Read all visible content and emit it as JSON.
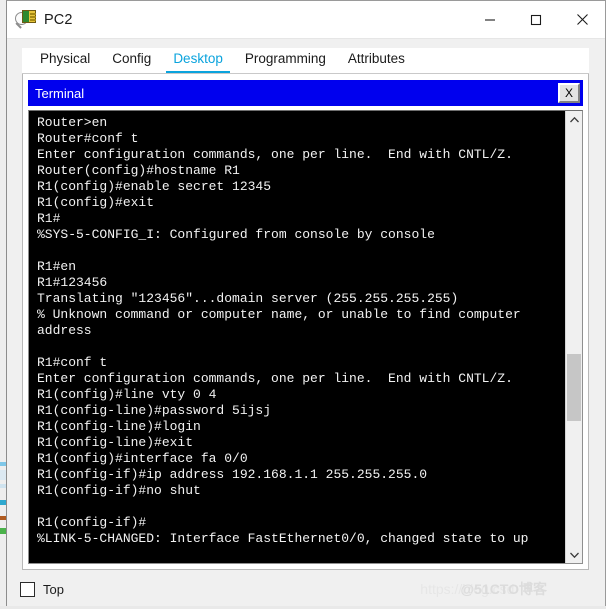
{
  "window": {
    "title": "PC2",
    "icon": "packet-tracer-pc-icon",
    "controls": {
      "minimize": "–",
      "maximize": "□",
      "close": "✕"
    }
  },
  "tabs": [
    {
      "label": "Physical",
      "active": false
    },
    {
      "label": "Config",
      "active": false
    },
    {
      "label": "Desktop",
      "active": true
    },
    {
      "label": "Programming",
      "active": false
    },
    {
      "label": "Attributes",
      "active": false
    }
  ],
  "terminal": {
    "title": "Terminal",
    "close_label": "X",
    "lines": [
      "Router>en",
      "Router#conf t",
      "Enter configuration commands, one per line.  End with CNTL/Z.",
      "Router(config)#hostname R1",
      "R1(config)#enable secret 12345",
      "R1(config)#exit",
      "R1#",
      "%SYS-5-CONFIG_I: Configured from console by console",
      "",
      "R1#en",
      "R1#123456",
      "Translating \"123456\"...domain server (255.255.255.255)",
      "% Unknown command or computer name, or unable to find computer",
      "address",
      "",
      "R1#conf t",
      "Enter configuration commands, one per line.  End with CNTL/Z.",
      "R1(config)#line vty 0 4",
      "R1(config-line)#password 5ijsj",
      "R1(config-line)#login",
      "R1(config-line)#exit",
      "R1(config)#interface fa 0/0",
      "R1(config-if)#ip address 192.168.1.1 255.255.255.0",
      "R1(config-if)#no shut",
      "",
      "R1(config-if)#",
      "%LINK-5-CHANGED: Interface FastEthernet0/0, changed state to up"
    ],
    "scrollbar": {
      "up_arrow": "⌃",
      "down_arrow": "⌄",
      "thumb_top_pct": 54,
      "thumb_height_pct": 16
    },
    "colors": {
      "titlebar": "#0000ee",
      "screen_bg": "#000000",
      "screen_fg": "#f2f2f2"
    }
  },
  "footer": {
    "top_checkbox_label": "Top",
    "top_checkbox_checked": false,
    "watermark_url": "https://blog.csd",
    "watermark_site": "@51CTO博客"
  },
  "colors": {
    "accent": "#0aa3dd",
    "window_bg": "#f0f0f0",
    "titlebar_bg": "#ffffff"
  }
}
